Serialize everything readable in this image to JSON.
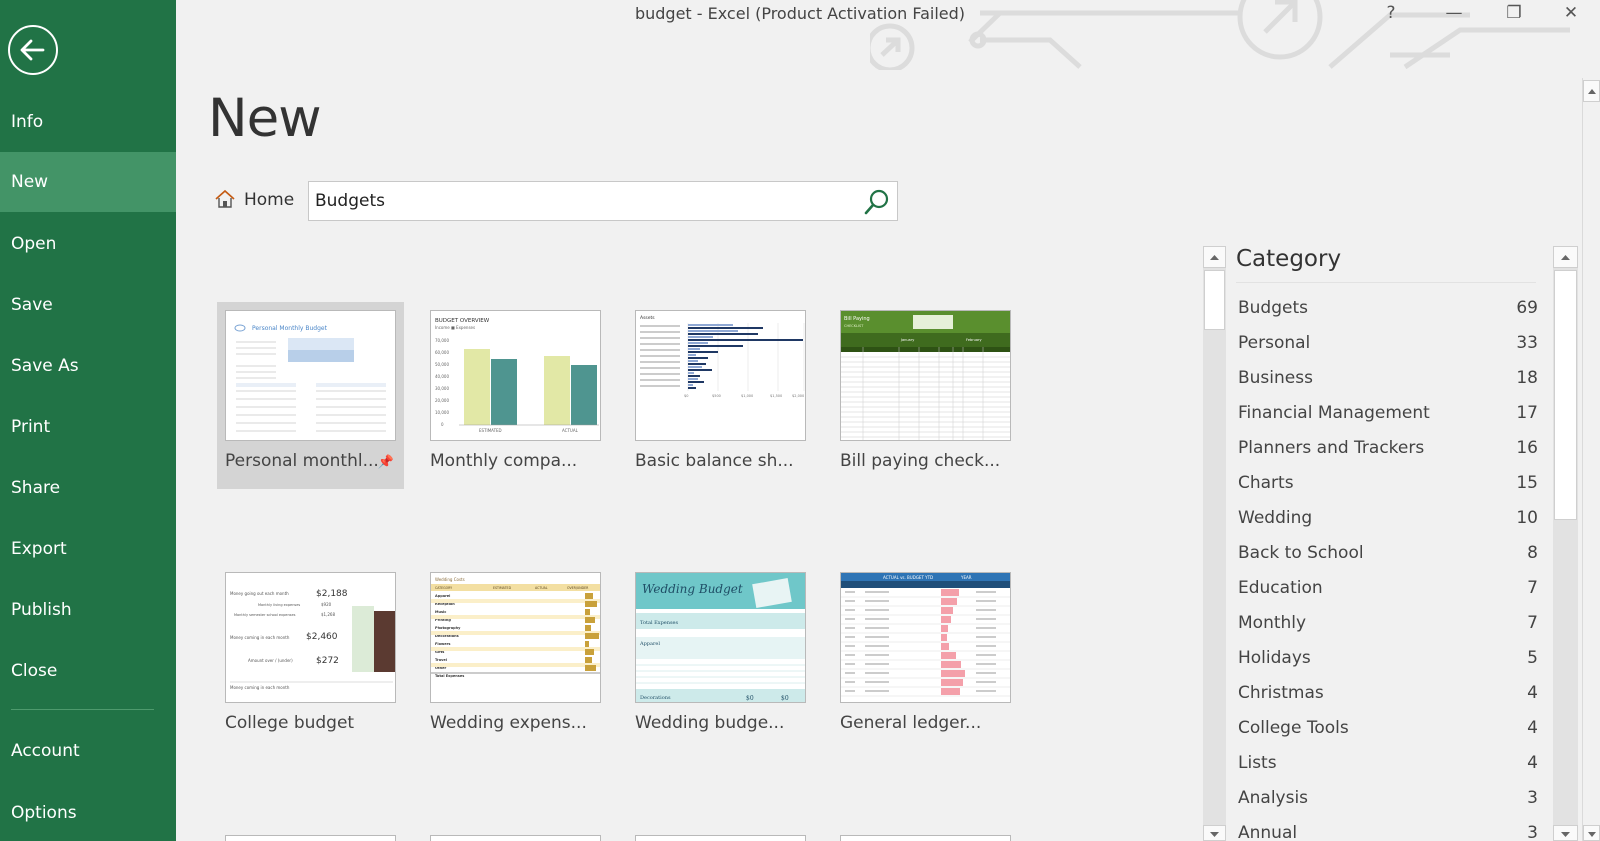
{
  "window": {
    "title": "budget - Excel (Product Activation Failed)",
    "help": "?",
    "minimize": "—",
    "restore": "❐",
    "close": "✕"
  },
  "sidebar": {
    "items": [
      {
        "label": "Info"
      },
      {
        "label": "New"
      },
      {
        "label": "Open"
      },
      {
        "label": "Save"
      },
      {
        "label": "Save As"
      },
      {
        "label": "Print"
      },
      {
        "label": "Share"
      },
      {
        "label": "Export"
      },
      {
        "label": "Publish"
      },
      {
        "label": "Close"
      },
      {
        "label": "Account"
      },
      {
        "label": "Options"
      }
    ],
    "active": "New",
    "accent": "#217346",
    "active_bg": "#439467"
  },
  "main": {
    "title": "New",
    "home_label": "Home",
    "search_value": "Budgets"
  },
  "templates": [
    {
      "label": "Personal monthl...",
      "pinned": true,
      "selected": true
    },
    {
      "label": "Monthly compa..."
    },
    {
      "label": "Basic balance sh..."
    },
    {
      "label": "Bill paying check..."
    },
    {
      "label": "College budget"
    },
    {
      "label": "Wedding expens..."
    },
    {
      "label": "Wedding budge..."
    },
    {
      "label": "General ledger..."
    }
  ],
  "thumbs": {
    "personal": {
      "title": "Personal Monthly Budget"
    },
    "monthly": {
      "title": "BUDGET OVERVIEW",
      "legend": "Income ■ Expenses",
      "yticks": [
        "70,000",
        "60,000",
        "50,000",
        "40,000",
        "30,000",
        "20,000",
        "10,000",
        "0"
      ],
      "xlabels": [
        "ESTIMATED",
        "ACTUAL"
      ]
    },
    "balance": {
      "title": "Assets",
      "xticks": [
        "$0",
        "$500",
        "$1,000",
        "$1,500",
        "$2,000",
        "$2,500"
      ]
    },
    "bill": {
      "title": "Bill Paying",
      "subtitle": "CHECKLIST",
      "col1": "January",
      "col2": "February"
    },
    "college": {
      "rows": [
        {
          "label": "Money going out each month",
          "value": "$2,188"
        },
        {
          "label": "Monthly living expenses",
          "value": "$920"
        },
        {
          "label": "Monthly semester school expenses",
          "value": "$1,268"
        },
        {
          "label": "Money coming in each month",
          "value": "$2,460"
        },
        {
          "label": "Amount over / (under)",
          "value": "$272"
        }
      ],
      "footer": "Money coming in each month"
    },
    "wedexp": {
      "title": "Wedding Costs",
      "headers": [
        "CATEGORY",
        "ESTIMATED",
        "ACTUAL",
        "OVER/UNDER"
      ],
      "rows": [
        "Apparel",
        "Reception",
        "Music",
        "Printing",
        "Photography",
        "Decorations",
        "Flowers",
        "Gifts",
        "Travel",
        "Other"
      ],
      "total": "Total Expenses"
    },
    "wedbud": {
      "title": "Wedding Budget",
      "rows": [
        "Total Expenses",
        "Apparel",
        "Decorations"
      ],
      "values": [
        "$0",
        "$0"
      ]
    },
    "ledger": {
      "title": "ACTUAL vs. BUDGET YTD",
      "year": "YEAR"
    }
  },
  "category": {
    "title": "Category",
    "items": [
      {
        "name": "Budgets",
        "count": "69"
      },
      {
        "name": "Personal",
        "count": "33"
      },
      {
        "name": "Business",
        "count": "18"
      },
      {
        "name": "Financial Management",
        "count": "17"
      },
      {
        "name": "Planners and Trackers",
        "count": "16"
      },
      {
        "name": "Charts",
        "count": "15"
      },
      {
        "name": "Wedding",
        "count": "10"
      },
      {
        "name": "Back to School",
        "count": "8"
      },
      {
        "name": "Education",
        "count": "7"
      },
      {
        "name": "Monthly",
        "count": "7"
      },
      {
        "name": "Holidays",
        "count": "5"
      },
      {
        "name": "Christmas",
        "count": "4"
      },
      {
        "name": "College Tools",
        "count": "4"
      },
      {
        "name": "Lists",
        "count": "4"
      },
      {
        "name": "Analysis",
        "count": "3"
      },
      {
        "name": "Annual",
        "count": "3"
      }
    ]
  }
}
